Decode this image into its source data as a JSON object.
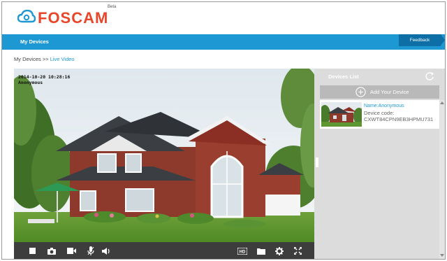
{
  "header": {
    "logo_text": "FOSCAM",
    "logo_badge": "Beta",
    "logo_icon": "foscam-cloud-icon"
  },
  "navbar": {
    "my_devices": "My Devices",
    "feedback": "Feedback"
  },
  "breadcrumb": {
    "root": "My Devices",
    "separator": ">>",
    "current": "Live Video"
  },
  "video": {
    "timestamp": "2014-10-20 10:28:16",
    "camera_name": "Anonymous",
    "controls_left": [
      "stop-icon",
      "snapshot-camera-icon",
      "record-video-icon",
      "microphone-icon",
      "speaker-icon"
    ],
    "controls_right": [
      "hd-badge-icon",
      "folder-icon",
      "settings-gear-icon",
      "fullscreen-icon"
    ],
    "hd_label": "HD"
  },
  "devices_panel": {
    "title": "Devices List",
    "add_label": "Add Your Device",
    "devices": [
      {
        "name": "Name:Anonymous",
        "code_label": "Device code:",
        "code": "CXWT84CPN9EB3HPMU731"
      }
    ]
  },
  "colors": {
    "brand_red": "#e8462a",
    "nav_blue": "#1e98d3",
    "feedback_blue": "#0e6fa6",
    "control_bar": "#3d3d3d",
    "panel_gray": "#dcdcdc"
  }
}
